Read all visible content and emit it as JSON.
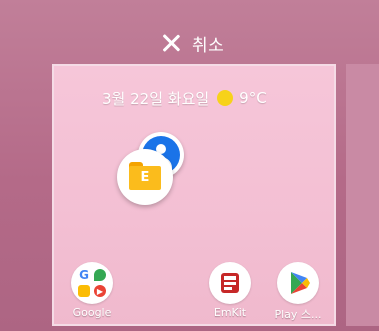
{
  "cancel": {
    "label": "취소",
    "icon": "close-icon"
  },
  "status": {
    "date": "3월 22일 화요일",
    "weather_icon": "sun-icon",
    "temperature": "9°C"
  },
  "dragged_icons": [
    {
      "name": "contacts-icon",
      "color": "#1a73e8"
    },
    {
      "name": "file-manager-icon",
      "letter": "E",
      "color": "#fbbc1c"
    }
  ],
  "apps": [
    {
      "label": "Google",
      "icon": "google-folder-icon"
    },
    {
      "label": "EmKit",
      "icon": "emkit-icon"
    },
    {
      "label": "Play 스...",
      "icon": "play-store-icon"
    }
  ],
  "colors": {
    "background": "#b46a88",
    "card": "#f4c1d5",
    "accent_blue": "#1a73e8",
    "accent_yellow": "#fbbc1c"
  }
}
